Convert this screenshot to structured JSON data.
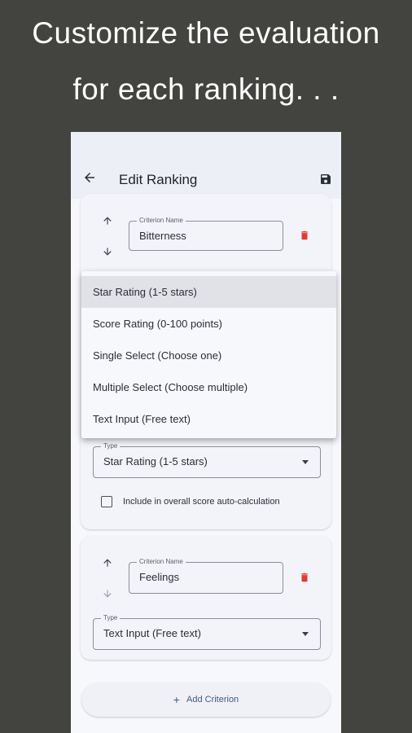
{
  "headline": {
    "line1": "Customize the evaluation",
    "line2": "for each ranking. . ."
  },
  "appbar": {
    "title": "Edit Ranking",
    "back_icon": "arrow-back-icon",
    "save_icon": "save-icon"
  },
  "criterion1": {
    "name_label": "Criterion Name",
    "name_value": "Bitterness",
    "type_label": "Type",
    "type_value": "Star Rating (1-5 stars)",
    "checkbox_label": "Include in overall score auto-calculation",
    "checkbox_checked": false
  },
  "criterion2": {
    "name_label": "Criterion Name",
    "name_value": "Feelings",
    "type_label": "Type",
    "type_value": "Text Input (Free text)"
  },
  "type_menu": {
    "items": [
      "Star Rating (1-5 stars)",
      "Score Rating (0-100 points)",
      "Single Select (Choose one)",
      "Multiple Select (Choose multiple)",
      "Text Input (Free text)"
    ],
    "selected": "Star Rating (1-5 stars)"
  },
  "add_button": {
    "label": "Add Criterion",
    "icon": "+"
  },
  "colors": {
    "background": "#434440",
    "delete": "#e53935",
    "accent": "#3e5a86"
  }
}
